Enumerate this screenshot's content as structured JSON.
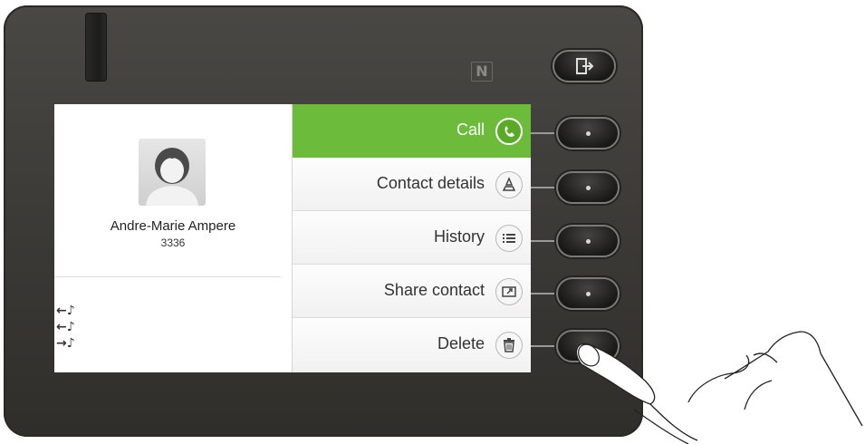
{
  "contact": {
    "name": "Andre-Marie Ampere",
    "number": "3336"
  },
  "history_icons": [
    {
      "icon": "incoming-call-icon",
      "glyph": "←♪"
    },
    {
      "icon": "incoming-call-icon",
      "glyph": "←♪"
    },
    {
      "icon": "outgoing-call-icon",
      "glyph": "→♪"
    }
  ],
  "menu": {
    "items": [
      {
        "label": "Call",
        "icon": "phone-icon",
        "active": true
      },
      {
        "label": "Contact details",
        "icon": "person-icon",
        "active": false
      },
      {
        "label": "History",
        "icon": "list-icon",
        "active": false
      },
      {
        "label": "Share contact",
        "icon": "share-icon",
        "active": false
      },
      {
        "label": "Delete",
        "icon": "trash-icon",
        "active": false
      }
    ]
  },
  "device": {
    "nfc_label": "N"
  },
  "colors": {
    "accent": "#6dbb3a",
    "device_body": "#3a3936"
  }
}
